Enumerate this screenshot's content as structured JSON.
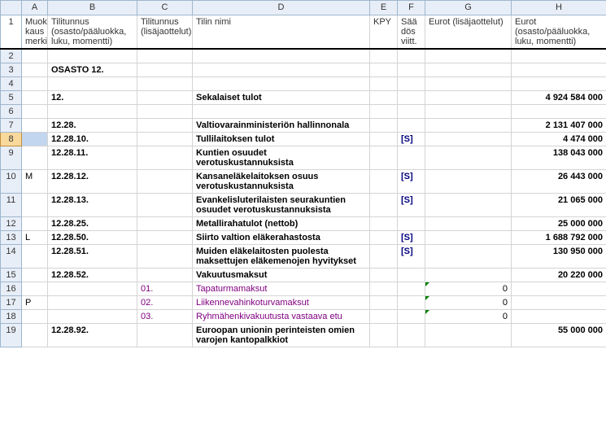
{
  "columns": {
    "A": "A",
    "B": "B",
    "C": "C",
    "D": "D",
    "E": "E",
    "F": "F",
    "G": "G",
    "H": "H"
  },
  "headers": {
    "A": "Muok\nkaus\nmerki",
    "B": "Tilitunnus\n(osasto/pääluokka,\nluku, momentti)",
    "C": "Tilitunnus\n(lisäjaottelut)",
    "D": "Tilin nimi",
    "E": "KPY",
    "F": "Sää\ndös\nviitt.",
    "G": "Eurot (lisäjaottelut)",
    "H": "Eurot\n(osasto/pääluokka,\nluku, momentti)"
  },
  "rows": [
    {
      "n": "2"
    },
    {
      "n": "3",
      "B": "OSASTO 12.",
      "bold": true
    },
    {
      "n": "4"
    },
    {
      "n": "5",
      "B": "12.",
      "D": "Sekalaiset tulot",
      "H": "4 924 584 000",
      "bold": true
    },
    {
      "n": "6"
    },
    {
      "n": "7",
      "B": "12.28.",
      "D": "Valtiovarainministeriön hallinnonala",
      "H": "2 131 407 000",
      "bold": true
    },
    {
      "n": "8",
      "B": "12.28.10.",
      "D": "Tullilaitoksen tulot",
      "F": "[S]",
      "H": "4 474 000",
      "bold": true,
      "sel": true
    },
    {
      "n": "9",
      "B": "12.28.11.",
      "D": "Kuntien osuudet verotuskustannuksista",
      "H": "138 043 000",
      "bold": true
    },
    {
      "n": "10",
      "A": "M",
      "B": "12.28.12.",
      "D": "Kansaneläkelaitoksen osuus verotuskustannuksista",
      "F": "[S]",
      "H": "26 443 000",
      "bold": true
    },
    {
      "n": "11",
      "B": "12.28.13.",
      "D": "Evankelisluterilaisten seurakuntien osuudet verotuskustannuksista",
      "F": "[S]",
      "H": "21 065 000",
      "bold": true
    },
    {
      "n": "12",
      "B": "12.28.25.",
      "D": "Metallirahatulot (nettob)",
      "H": "25 000 000",
      "bold": true
    },
    {
      "n": "13",
      "A": "L",
      "B": "12.28.50.",
      "D": "Siirto valtion eläkerahastosta",
      "F": "[S]",
      "H": "1 688 792 000",
      "bold": true
    },
    {
      "n": "14",
      "B": "12.28.51.",
      "D": "Muiden eläkelaitosten puolesta maksettujen eläkemenojen hyvitykset",
      "F": "[S]",
      "H": "130 950 000",
      "bold": true
    },
    {
      "n": "15",
      "B": "12.28.52.",
      "D": "Vakuutusmaksut",
      "H": "20 220 000",
      "bold": true
    },
    {
      "n": "16",
      "C": "01.",
      "D": "Tapaturmamaksut",
      "G": "0",
      "purple": true,
      "tri": true
    },
    {
      "n": "17",
      "A": "P",
      "C": "02.",
      "D": "Liikennevahinkoturvamaksut",
      "G": "0",
      "purple": true,
      "tri": true
    },
    {
      "n": "18",
      "C": "03.",
      "D": "Ryhmähenkivakuutusta vastaava etu",
      "G": "0",
      "purple": true,
      "tri": true
    },
    {
      "n": "19",
      "B": "12.28.92.",
      "D": "Euroopan unionin perinteisten omien varojen kantopalkkiot",
      "H": "55 000 000",
      "bold": true
    }
  ]
}
